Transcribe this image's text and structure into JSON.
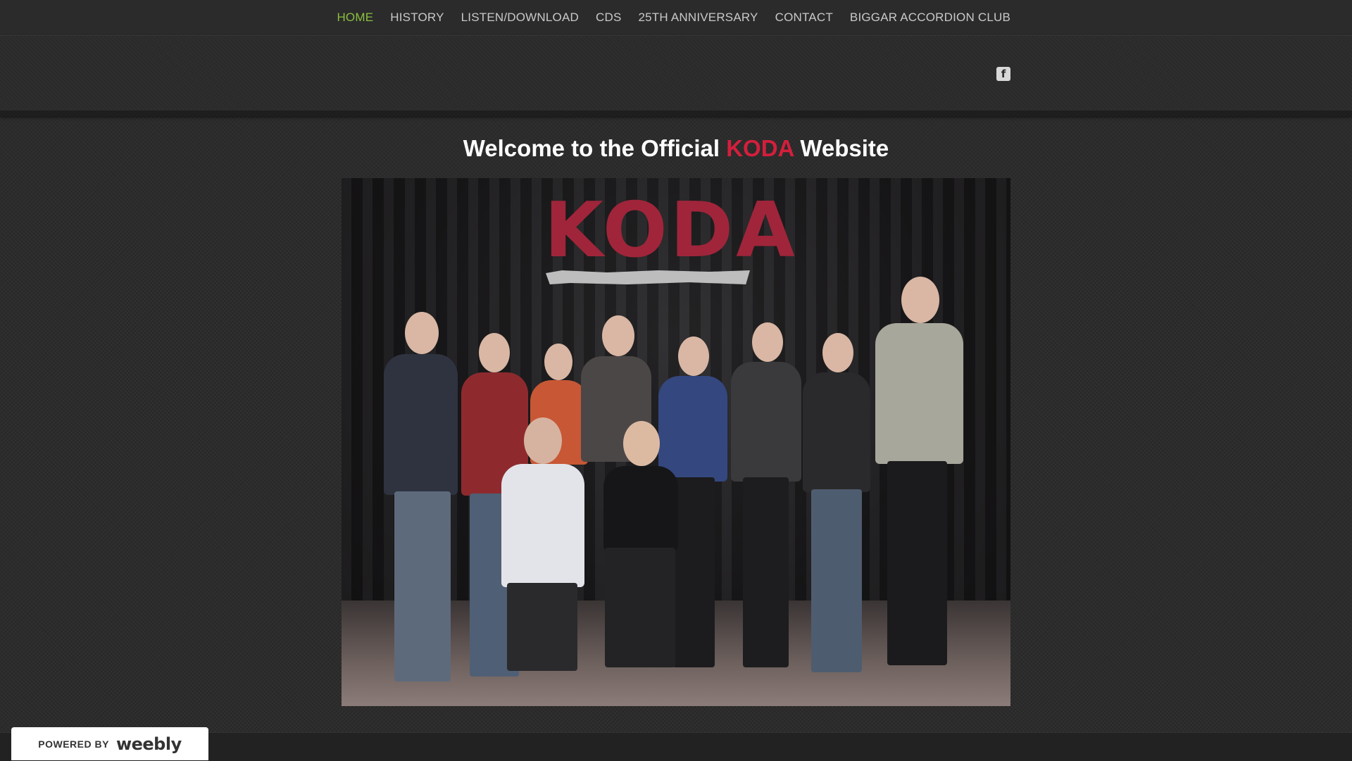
{
  "nav": {
    "items": [
      {
        "label": "HOME",
        "active": true
      },
      {
        "label": "HISTORY",
        "active": false
      },
      {
        "label": "LISTEN/DOWNLOAD",
        "active": false
      },
      {
        "label": "CDS",
        "active": false
      },
      {
        "label": "25TH ANNIVERSARY",
        "active": false
      },
      {
        "label": "CONTACT",
        "active": false
      },
      {
        "label": "BIGGAR ACCORDION CLUB",
        "active": false
      }
    ],
    "active_color": "#8bbf3f",
    "text_color": "#c9c9c9"
  },
  "header": {
    "social_icon": "facebook-icon",
    "social_glyph": "f"
  },
  "main": {
    "welcome_prefix": "Welcome to the Official",
    "welcome_accent": "KODA",
    "welcome_suffix": "Website",
    "accent_color": "#d21f3c",
    "photo": {
      "logo_text": "KODA",
      "logo_color": "#a0253a"
    }
  },
  "footer": {
    "powered_by": "POWERED BY",
    "brand": "weebly"
  }
}
